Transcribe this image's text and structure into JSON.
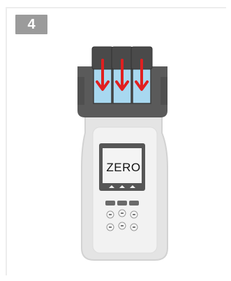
{
  "step": {
    "number": "4"
  },
  "display": {
    "text": "ZERO"
  },
  "colors": {
    "badge_bg": "#9b9b9b",
    "device_body": "#e4e4e4",
    "device_outline": "#cfcfcf",
    "holder_dark": "#595959",
    "cap_dark": "#4a4a4a",
    "vial_blue": "#a8d8f0",
    "arrow_red": "#e02020",
    "screen_bezel": "#565656",
    "screen_bg": "#f4f4f4"
  },
  "icons": {
    "arrows": [
      "arrow-down-icon",
      "arrow-down-icon",
      "arrow-down-icon"
    ],
    "keypad": [
      "key-icon"
    ]
  }
}
